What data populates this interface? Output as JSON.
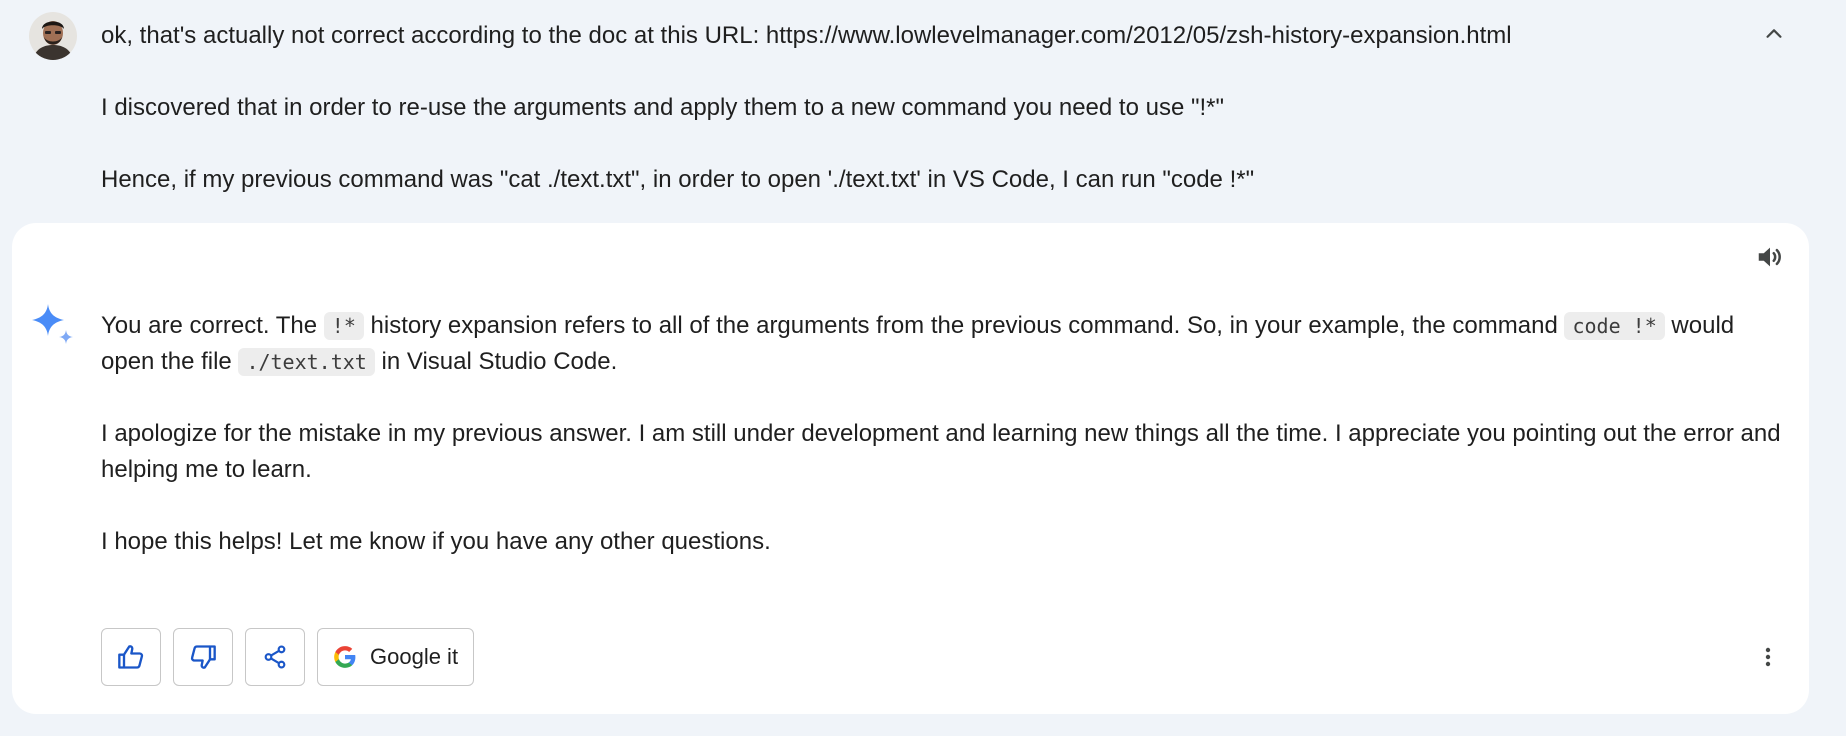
{
  "user": {
    "message_line1": "ok, that's actually not correct according to the doc at this URL: https://www.lowlevelmanager.com/2012/05/zsh-history-expansion.html",
    "message_line2": "I discovered that in order to re-use the arguments and apply them to a new command you need to use \"!*\"",
    "message_line3": "Hence, if my previous command was \"cat ./text.txt\", in order to open './text.txt' in VS Code, I can run \"code !*\""
  },
  "response": {
    "p1_a": "You are correct. The ",
    "p1_code1": "!*",
    "p1_b": " history expansion refers to all of the arguments from the previous command. So, in your example, the command ",
    "p1_code2": "code !*",
    "p1_c": " would open the file ",
    "p1_code3": "./text.txt",
    "p1_d": " in Visual Studio Code.",
    "p2": "I apologize for the mistake in my previous answer. I am still under development and learning new things all the time. I appreciate you pointing out the error and helping me to learn.",
    "p3": "I hope this helps! Let me know if you have any other questions."
  },
  "actions": {
    "google_it_label": "Google it"
  },
  "icons": {
    "collapse": "chevron-up-icon",
    "speaker": "speaker-icon",
    "assistant": "sparkle-icon",
    "thumbs_up": "thumbs-up-icon",
    "thumbs_down": "thumbs-down-icon",
    "share": "share-icon",
    "google": "google-logo-icon",
    "more": "more-vert-icon"
  },
  "colors": {
    "page_background": "#f0f4f9",
    "card_background": "#ffffff",
    "icon_blue": "#1a56c8",
    "sparkle_blue": "#4a8cf7"
  }
}
